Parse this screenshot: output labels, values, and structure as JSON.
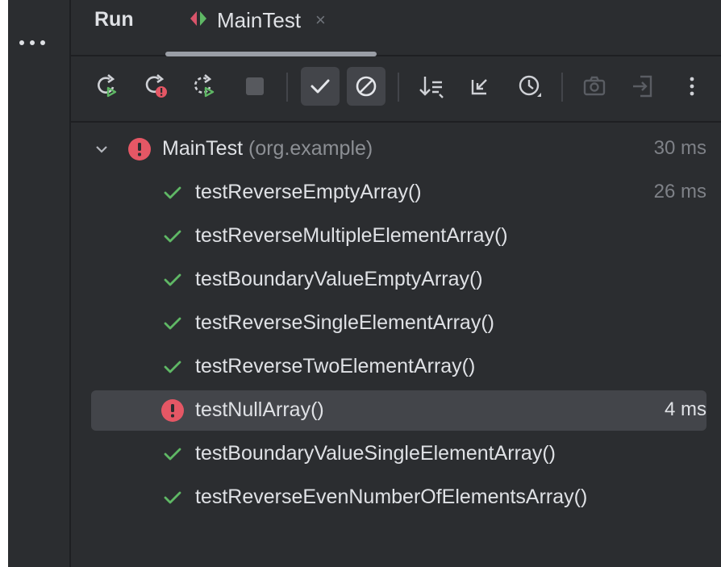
{
  "tabs": {
    "run_label": "Run",
    "active_tab_label": "MainTest",
    "close_symbol": "×"
  },
  "toolbar": {
    "buttons": [
      {
        "name": "rerun-icon",
        "enabled": true
      },
      {
        "name": "rerun-failed-icon",
        "enabled": true
      },
      {
        "name": "rerun-automatically-icon",
        "enabled": true
      },
      {
        "name": "stop-icon",
        "enabled": false
      },
      {
        "name": "show-passed-toggle-icon",
        "selected": true
      },
      {
        "name": "show-ignored-toggle-icon",
        "selected": true
      },
      {
        "name": "sort-alphabetically-icon",
        "enabled": true
      },
      {
        "name": "collapse-all-icon",
        "enabled": true
      },
      {
        "name": "sort-by-duration-icon",
        "enabled": true
      },
      {
        "name": "camera-icon",
        "enabled": false
      },
      {
        "name": "import-tests-icon",
        "enabled": false
      },
      {
        "name": "more-options-icon",
        "enabled": true
      }
    ]
  },
  "test_tree": {
    "root": {
      "name": "MainTest",
      "package": "(org.example)",
      "time": "30 ms",
      "status": "failed",
      "expanded": true
    },
    "tests": [
      {
        "name": "testReverseEmptyArray()",
        "status": "passed",
        "time": "26 ms"
      },
      {
        "name": "testReverseMultipleElementArray()",
        "status": "passed",
        "time": ""
      },
      {
        "name": "testBoundaryValueEmptyArray()",
        "status": "passed",
        "time": ""
      },
      {
        "name": "testReverseSingleElementArray()",
        "status": "passed",
        "time": ""
      },
      {
        "name": "testReverseTwoElementArray()",
        "status": "passed",
        "time": ""
      },
      {
        "name": "testNullArray()",
        "status": "failed",
        "time": "4 ms",
        "selected": true
      },
      {
        "name": "testBoundaryValueSingleElementArray()",
        "status": "passed",
        "time": ""
      },
      {
        "name": "testReverseEvenNumberOfElementsArray()",
        "status": "passed",
        "time": ""
      }
    ]
  },
  "colors": {
    "background": "#2b2d30",
    "text": "#dfe1e5",
    "muted": "#8c8f94",
    "pass": "#5fb865",
    "fail": "#e55765",
    "selected_row": "#43454a"
  }
}
